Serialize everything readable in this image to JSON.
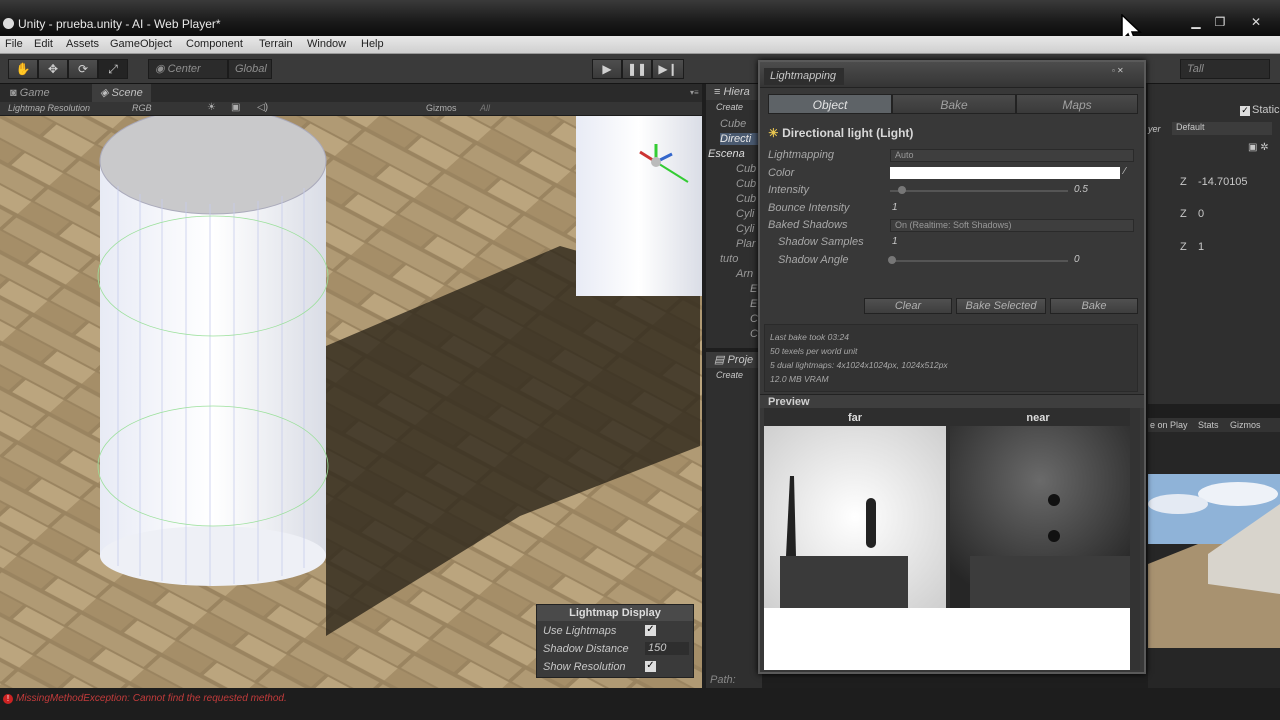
{
  "window": {
    "title": "Unity - prueba.unity - AI - Web Player*"
  },
  "menu": [
    "File",
    "Edit",
    "Assets",
    "GameObject",
    "Component",
    "Terrain",
    "Window",
    "Help"
  ],
  "toolbar": {
    "pivot": "Center",
    "space": "Global",
    "layout": "Tall"
  },
  "scene": {
    "tabs": [
      "Game",
      "Scene"
    ],
    "render_mode": "Lightmap Resolution",
    "color_mode": "RGB",
    "gizmos": "Gizmos",
    "search": "All"
  },
  "hierarchy": {
    "tab": "Hiera",
    "create": "Create",
    "items": [
      "Cube",
      "Directi",
      "Escena",
      "Cub",
      "Cub",
      "Cub",
      "Cyli",
      "Cyli",
      "Plar",
      "tuto",
      "Arn",
      "E",
      "E",
      "C",
      "C"
    ]
  },
  "project": {
    "tab": "Proje",
    "create": "Create",
    "path_label": "Path:"
  },
  "lightmapping": {
    "title": "Lightmapping",
    "tabs": [
      "Object",
      "Bake",
      "Maps"
    ],
    "object_name": "Directional light (Light)",
    "fields": {
      "lightmapping_label": "Lightmapping",
      "lightmapping_value": "Auto",
      "color_label": "Color",
      "color_value": "#ffffff",
      "intensity_label": "Intensity",
      "intensity_value": "0.5",
      "bounce_label": "Bounce Intensity",
      "bounce_value": "1",
      "baked_shadows_label": "Baked Shadows",
      "baked_shadows_value": "On (Realtime: Soft Shadows)",
      "shadow_samples_label": "Shadow Samples",
      "shadow_samples_value": "1",
      "shadow_angle_label": "Shadow Angle",
      "shadow_angle_value": "0"
    },
    "buttons": [
      "Clear",
      "Bake Selected",
      "Bake"
    ],
    "info": [
      "Last bake took 03:24",
      "50 texels per world unit",
      "5 dual lightmaps: 4x1024x1024px, 1024x512px",
      "12.0 MB VRAM"
    ],
    "preview_label": "Preview",
    "preview_far": "far",
    "preview_near": "near"
  },
  "lightmap_display": {
    "title": "Lightmap Display",
    "use_lightmaps_label": "Use Lightmaps",
    "use_lightmaps": true,
    "shadow_distance_label": "Shadow Distance",
    "shadow_distance": "150",
    "show_resolution_label": "Show Resolution",
    "show_resolution": true
  },
  "inspector": {
    "static_label": "Static",
    "layer_label": "yer",
    "layer_value": "Default",
    "pos_z_label": "Z",
    "pos_z": "-14.70105",
    "rot_z_label": "Z",
    "rot_z": "0",
    "scale_z_label": "Z",
    "scale_z": "1"
  },
  "game_view": {
    "maximize": "e on Play",
    "stats": "Stats",
    "gizmos": "Gizmos"
  },
  "status": {
    "error": "MissingMethodException: Cannot find the requested method."
  }
}
